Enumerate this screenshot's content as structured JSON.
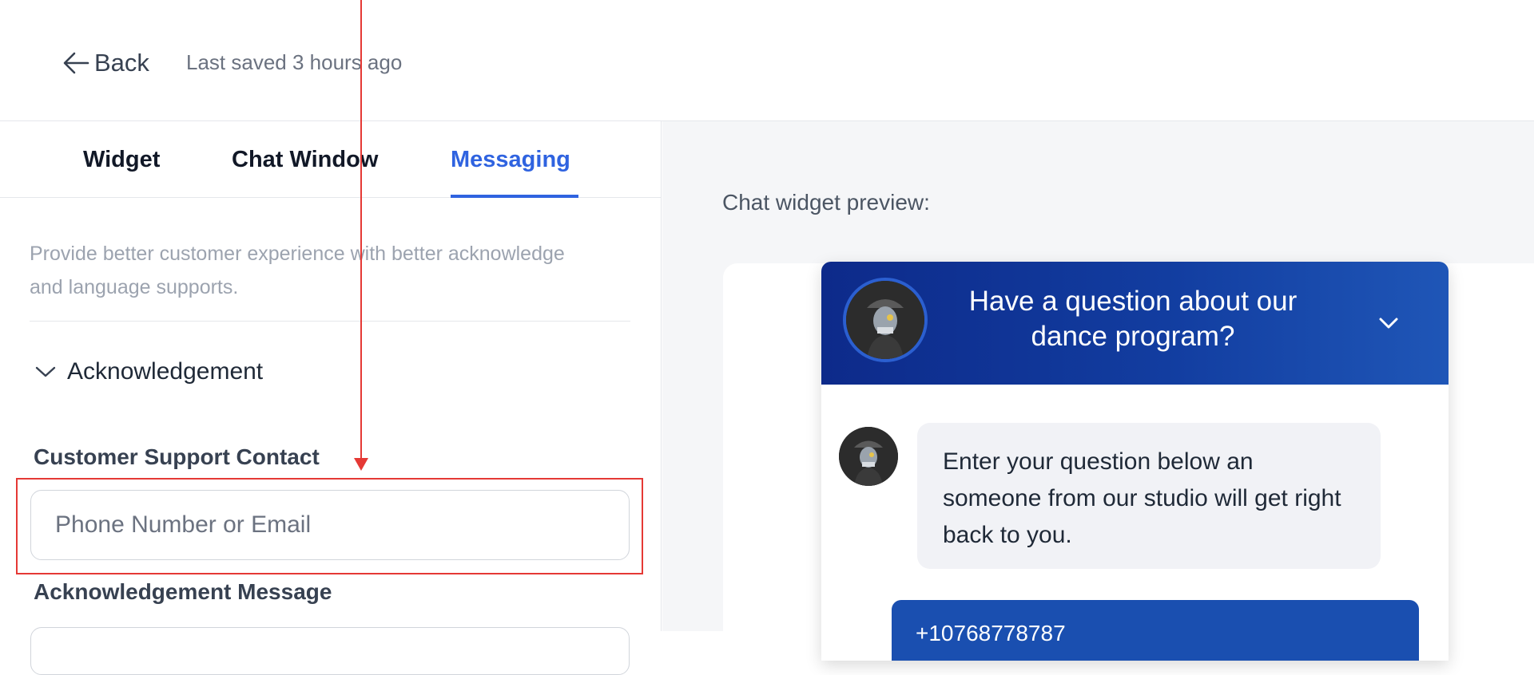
{
  "topbar": {
    "back_label": "Back",
    "last_saved": "Last saved 3 hours ago"
  },
  "tabs": [
    {
      "label": "Widget",
      "active": false
    },
    {
      "label": "Chat Window",
      "active": false
    },
    {
      "label": "Messaging",
      "active": true
    }
  ],
  "messaging": {
    "intro": "Provide better customer experience with better acknowledge and language supports.",
    "section_title": "Acknowledgement",
    "support_contact_label": "Customer Support Contact",
    "support_contact_placeholder": "Phone Number or Email",
    "support_contact_value": "",
    "ack_message_label": "Acknowledgement Message"
  },
  "preview": {
    "label": "Chat widget preview:",
    "chat_title": "Have a question about our dance program?",
    "bot_message": "Enter your question below an someone from our studio will get right back to you.",
    "user_message": "+10768778787"
  },
  "colors": {
    "accent": "#2f63e0",
    "header_start": "#0d2a8a",
    "header_end": "#1f56b7",
    "annotation": "#e53935"
  },
  "icons": {
    "back": "arrow-left-icon",
    "section": "chevron-down-icon",
    "collapse": "chevron-down-icon"
  }
}
